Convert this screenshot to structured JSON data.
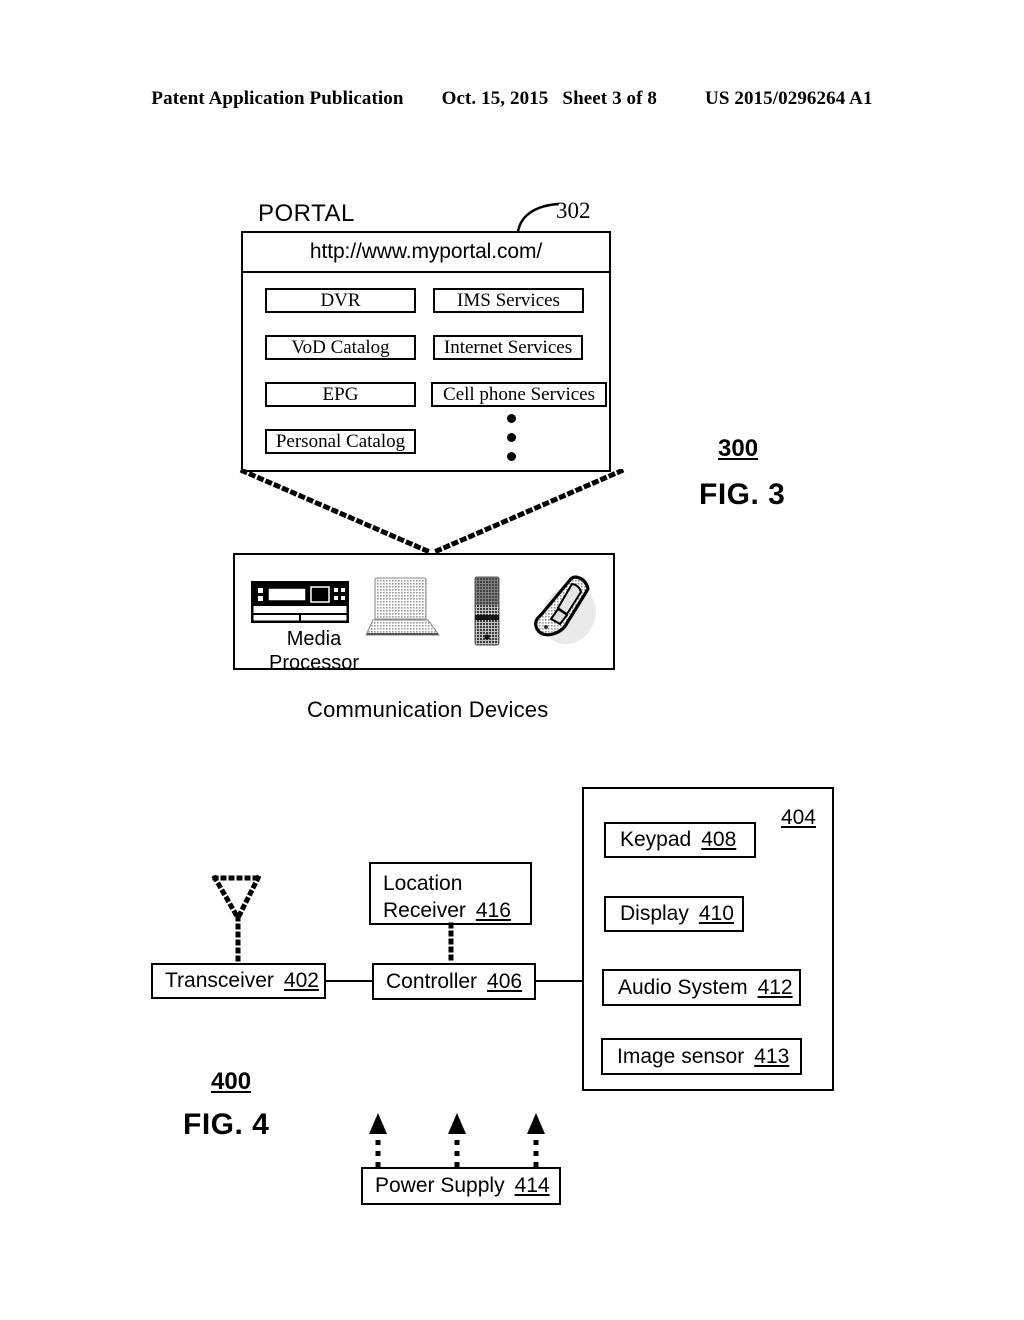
{
  "header": {
    "left": "Patent Application Publication",
    "date": "Oct. 15, 2015",
    "sheet": "Sheet 3 of 8",
    "pub_number": "US 2015/0296264 A1"
  },
  "figure3": {
    "portal_title": "PORTAL",
    "portal_ref": "302",
    "url": "http://www.myportal.com/",
    "services_left": [
      {
        "label": "DVR"
      },
      {
        "label": "VoD Catalog"
      },
      {
        "label": "EPG"
      },
      {
        "label": "Personal Catalog"
      }
    ],
    "services_right": [
      {
        "label": "IMS Services"
      },
      {
        "label": "Internet Services"
      },
      {
        "label": "Cell phone Services"
      }
    ],
    "more_indicator": "vertical-ellipsis",
    "devices": {
      "media_processor_label": "Media\nProcessor",
      "media_processor_label_line1": "Media",
      "media_processor_label_line2": "Processor",
      "icons": [
        "set-top-box",
        "laptop",
        "mobile-phone",
        "flip-phone"
      ]
    },
    "devices_caption": "Communication Devices",
    "figure_ref": "300",
    "figure_name": "FIG. 3"
  },
  "figure4": {
    "blocks": [
      {
        "id": "transceiver",
        "label": "Transceiver",
        "ref": "402"
      },
      {
        "id": "controller",
        "label": "Controller",
        "ref": "406"
      },
      {
        "id": "location_receiver",
        "label_line1": "Location",
        "label_line2": "Receiver",
        "ref": "416"
      },
      {
        "id": "keypad",
        "label": "Keypad",
        "ref": "408"
      },
      {
        "id": "display",
        "label": "Display",
        "ref": "410"
      },
      {
        "id": "audio_system",
        "label": "Audio System",
        "ref": "412"
      },
      {
        "id": "image_sensor",
        "label": "Image sensor",
        "ref": "413"
      },
      {
        "id": "power_supply",
        "label": "Power Supply",
        "ref": "414"
      }
    ],
    "ui_block_ref": "404",
    "figure_ref": "400",
    "figure_name": "FIG. 4"
  },
  "colors": {
    "ink": "#000000",
    "paper": "#ffffff"
  }
}
